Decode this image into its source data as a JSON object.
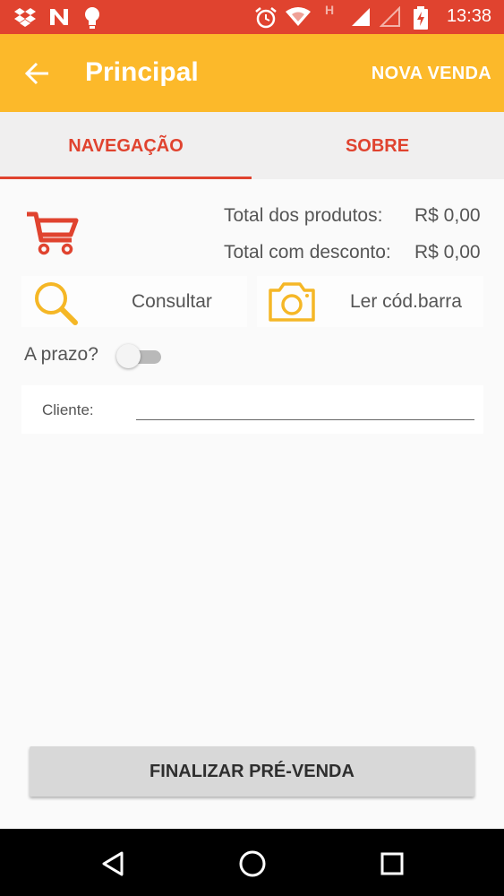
{
  "status_bar": {
    "time": "13:38",
    "icons": [
      "dropbox-icon",
      "n-notification-icon",
      "lightbulb-icon",
      "alarm-icon",
      "wifi-icon",
      "h-network-icon",
      "signal-icon",
      "signal-empty-icon",
      "battery-charging-icon"
    ],
    "network_label": "H"
  },
  "app_bar": {
    "title": "Principal",
    "action_label": "NOVA VENDA",
    "background": "#fcb92a"
  },
  "tabs": [
    {
      "label": "NAVEGAÇÃO",
      "active": true
    },
    {
      "label": "SOBRE",
      "active": false
    }
  ],
  "totals": {
    "products_label": "Total dos produtos:",
    "products_value": "R$ 0,00",
    "discount_label": "Total com desconto:",
    "discount_value": "R$ 0,00"
  },
  "actions": {
    "consult_label": "Consultar",
    "barcode_label": "Ler cód.barra"
  },
  "prazo": {
    "label": "A prazo?",
    "checked": false
  },
  "cliente": {
    "label": "Cliente:",
    "value": ""
  },
  "finalize_label": "FINALIZAR PRÉ-VENDA",
  "colors": {
    "accent_red": "#e0432f",
    "accent_yellow": "#fcb92a"
  }
}
